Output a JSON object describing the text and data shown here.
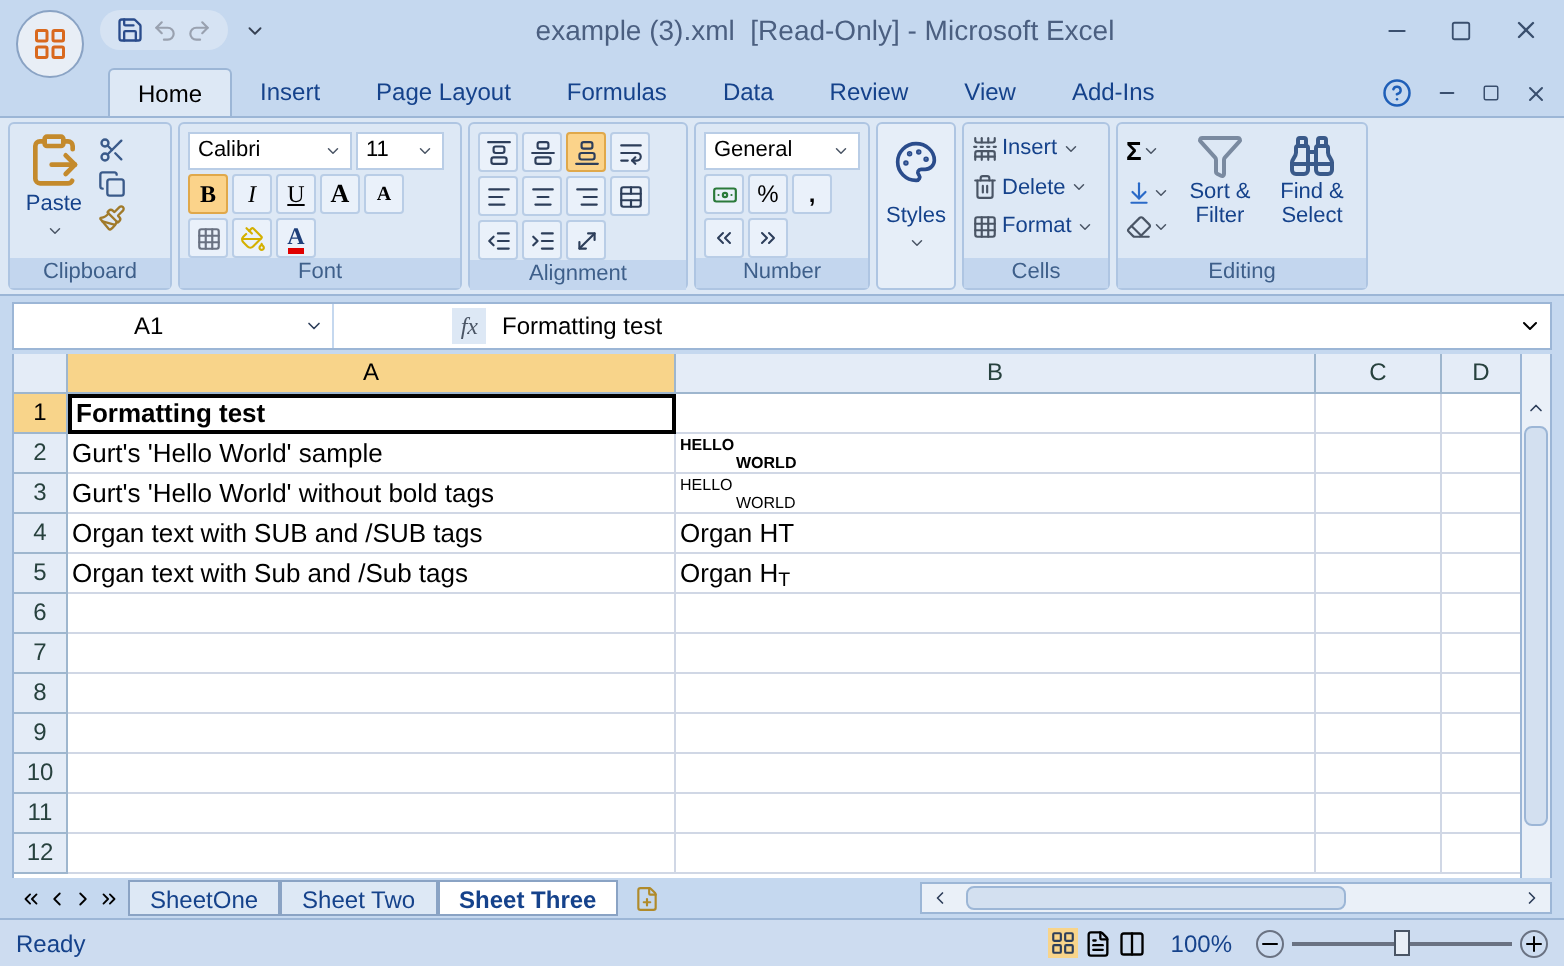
{
  "window": {
    "title": "example (3).xml  [Read-Only] - Microsoft Excel"
  },
  "ribbon_tabs": [
    {
      "label": "Home",
      "selected": true
    },
    {
      "label": "Insert",
      "selected": false
    },
    {
      "label": "Page Layout",
      "selected": false
    },
    {
      "label": "Formulas",
      "selected": false
    },
    {
      "label": "Data",
      "selected": false
    },
    {
      "label": "Review",
      "selected": false
    },
    {
      "label": "View",
      "selected": false
    },
    {
      "label": "Add-Ins",
      "selected": false
    }
  ],
  "clipboard": {
    "label": "Clipboard",
    "paste": "Paste"
  },
  "font": {
    "label": "Font",
    "name": "Calibri",
    "size": "11",
    "bold": {
      "text": "B",
      "on": true
    },
    "italic": {
      "text": "I",
      "on": false
    },
    "underline": {
      "text": "U",
      "on": false
    },
    "grow": "A",
    "shrink": "A",
    "font_color_letter": "A"
  },
  "alignment": {
    "label": "Alignment",
    "vertical": [
      {
        "kind": "top",
        "selected": false
      },
      {
        "kind": "middle",
        "selected": false
      },
      {
        "kind": "bottom",
        "selected": true
      }
    ]
  },
  "number": {
    "label": "Number",
    "format": "General",
    "percent": "%",
    "comma": ","
  },
  "styles": {
    "label": "Styles"
  },
  "cells": {
    "label": "Cells",
    "buttons": [
      {
        "kind": "insert",
        "label": "Insert"
      },
      {
        "kind": "delete",
        "label": "Delete"
      },
      {
        "kind": "format",
        "label": "Format"
      }
    ]
  },
  "editing": {
    "label": "Editing",
    "sum": "Σ",
    "sort": "Sort & Filter",
    "find": "Find & Select"
  },
  "formula_bar": {
    "name_box": "A1",
    "fx": "fx",
    "value": "Formatting test"
  },
  "columns": [
    {
      "label": "A",
      "selected": true
    },
    {
      "label": "B",
      "selected": false
    },
    {
      "label": "C",
      "selected": false
    },
    {
      "label": "D",
      "selected": false
    }
  ],
  "rows": [
    {
      "number": "1",
      "selected": true,
      "cells": [
        {
          "kind": "text",
          "text": "Formatting test",
          "bold": true
        },
        {
          "kind": "empty"
        }
      ]
    },
    {
      "number": "2",
      "selected": false,
      "cells": [
        {
          "kind": "text",
          "text": "Gurt's 'Hello World' sample",
          "bold": false
        },
        {
          "kind": "stacked",
          "upper": "HELLO",
          "lower": "WORLD",
          "bold": true
        }
      ]
    },
    {
      "number": "3",
      "selected": false,
      "cells": [
        {
          "kind": "text",
          "text": "Gurt's 'Hello World' without bold tags",
          "bold": false
        },
        {
          "kind": "stacked",
          "upper": "HELLO",
          "lower": "WORLD",
          "bold": false
        }
      ]
    },
    {
      "number": "4",
      "selected": false,
      "cells": [
        {
          "kind": "text",
          "text": "Organ text with SUB and /SUB tags",
          "bold": false
        },
        {
          "kind": "text",
          "text": "Organ HT",
          "bold": false
        }
      ]
    },
    {
      "number": "5",
      "selected": false,
      "cells": [
        {
          "kind": "text",
          "text": "Organ text with Sub and /Sub tags",
          "bold": false
        },
        {
          "kind": "text",
          "text": "Organ H$_{T}$",
          "bold": false
        }
      ]
    },
    {
      "number": "6",
      "selected": false,
      "cells": []
    },
    {
      "number": "7",
      "selected": false,
      "cells": []
    },
    {
      "number": "8",
      "selected": false,
      "cells": []
    },
    {
      "number": "9",
      "selected": false,
      "cells": []
    },
    {
      "number": "10",
      "selected": false,
      "cells": []
    },
    {
      "number": "11",
      "selected": false,
      "cells": []
    },
    {
      "number": "12",
      "selected": false,
      "cells": []
    }
  ],
  "sheet_tabs": [
    {
      "label": "SheetOne",
      "selected": false
    },
    {
      "label": "Sheet Two",
      "selected": false
    },
    {
      "label": "Sheet Three",
      "selected": true
    }
  ],
  "status_bar": {
    "status": "Ready",
    "zoom": "100%",
    "level": 0.5
  }
}
